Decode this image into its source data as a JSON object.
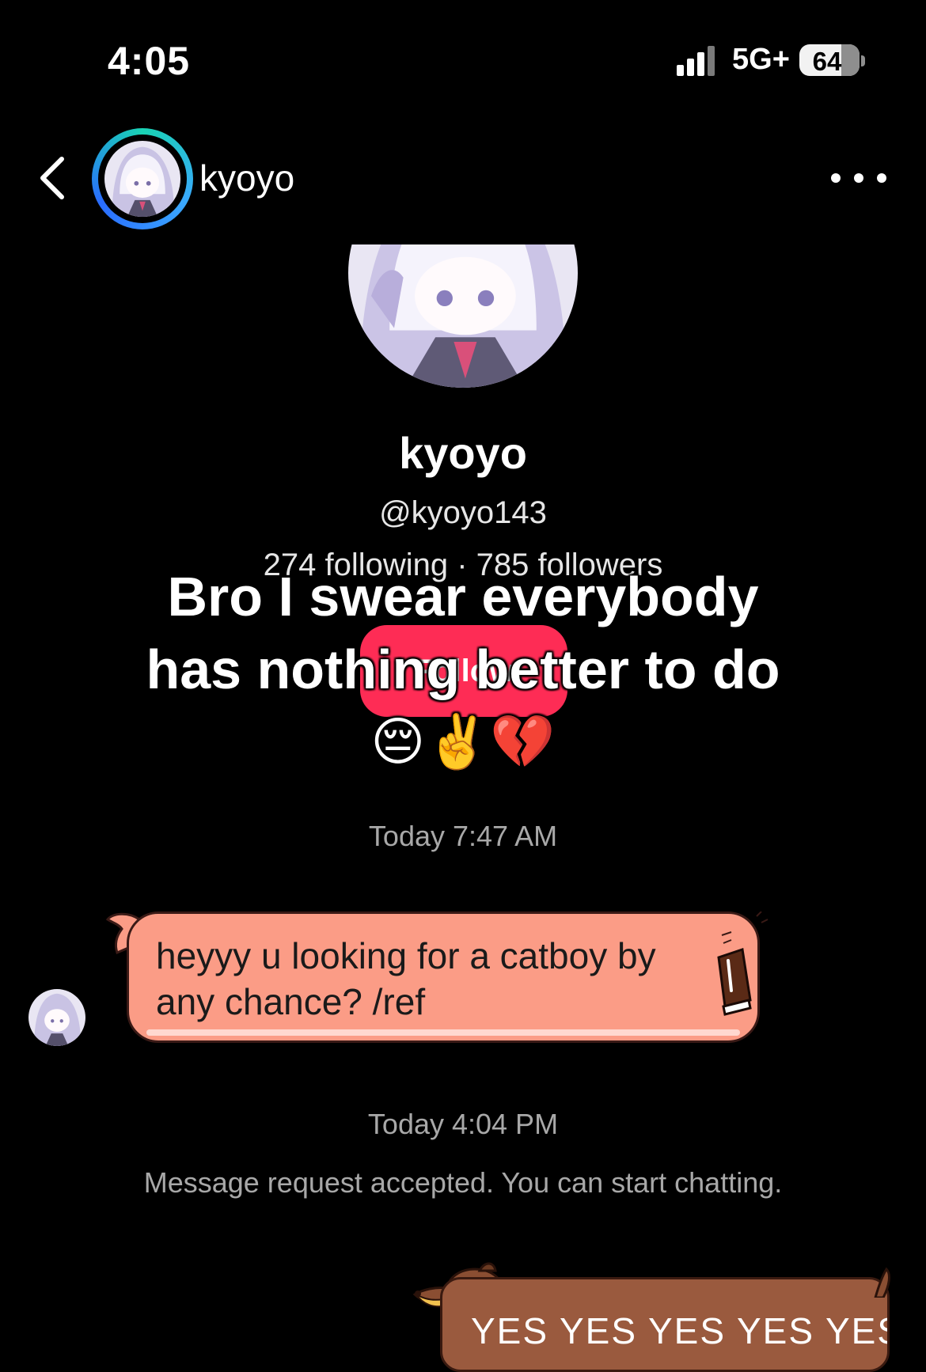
{
  "status_bar": {
    "time": "4:05",
    "network": "5G+",
    "battery": "64"
  },
  "header": {
    "title": "kyoyo",
    "back_icon": "chevron-left-icon",
    "more_icon": "more-horizontal-icon"
  },
  "profile": {
    "name": "kyoyo",
    "handle": "@kyoyo143",
    "stats": "274 following · 785 followers",
    "follow_label": "Follow"
  },
  "caption": {
    "line1": "Bro I swear everybody",
    "line2": "has nothing better to do",
    "emojis": "😔✌️💔"
  },
  "messages": {
    "timestamp_1": "Today 7:47 AM",
    "incoming_text": "heyyy u looking for a catboy by any chance? /ref",
    "timestamp_2": "Today 4:04 PM",
    "notice": "Message request accepted. You can start chatting.",
    "outgoing_text": "YES YES YES YES YES"
  },
  "colors": {
    "background": "#000000",
    "incoming_bubble": "#fb9c86",
    "outgoing_bubble": "#9a5a3e",
    "follow_button": "#fe2c55",
    "avatar_ring": "#19d3b4"
  }
}
